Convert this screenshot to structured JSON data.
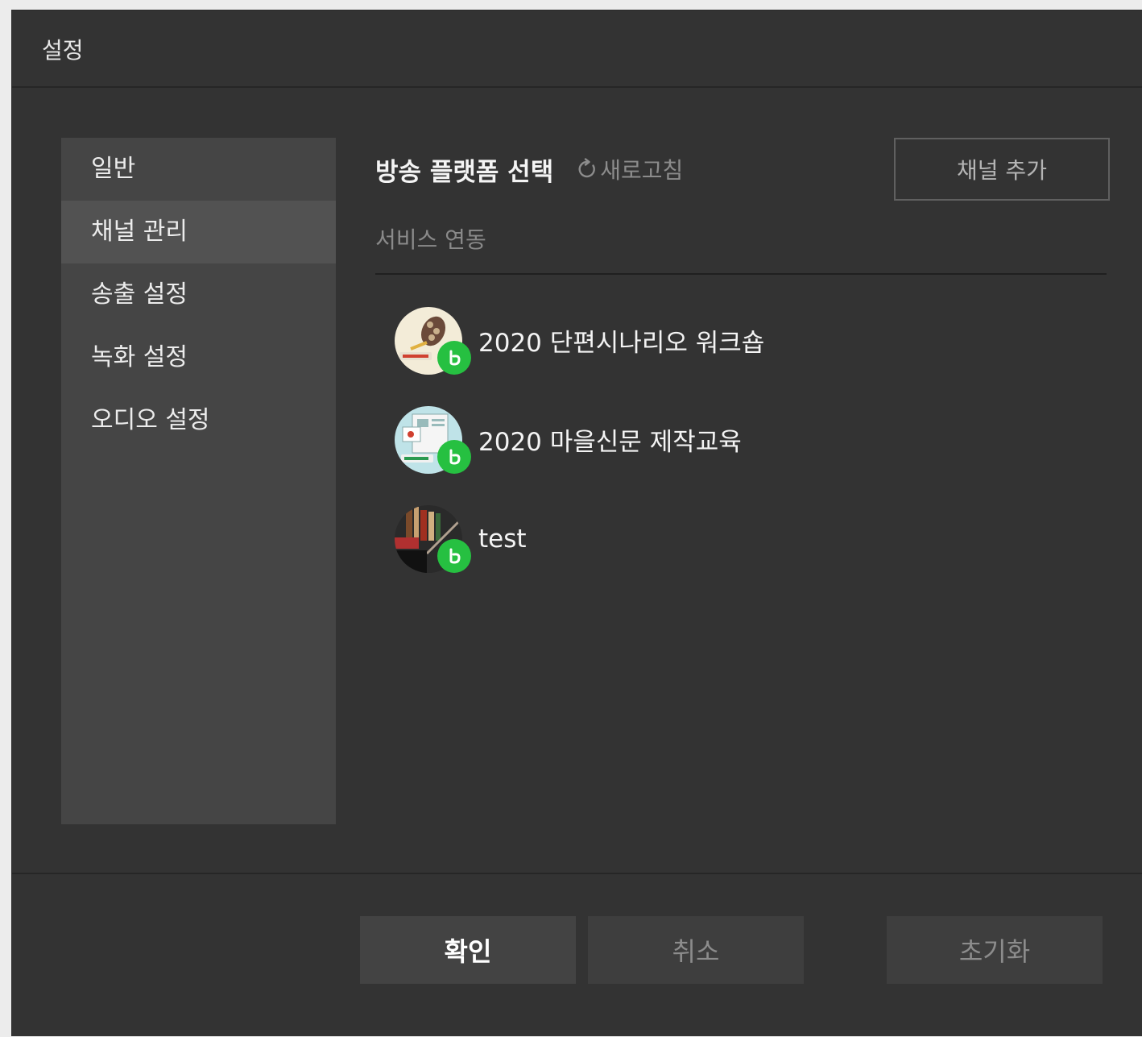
{
  "window": {
    "title": "설정"
  },
  "sidebar": {
    "items": [
      {
        "label": "일반",
        "active": false
      },
      {
        "label": "채널 관리",
        "active": true
      },
      {
        "label": "송출 설정",
        "active": false
      },
      {
        "label": "녹화 설정",
        "active": false
      },
      {
        "label": "오디오 설정",
        "active": false
      }
    ]
  },
  "main": {
    "section_title": "방송 플랫폼 선택",
    "refresh_label": "새로고침",
    "add_channel_label": "채널 추가",
    "service_label": "서비스 연동",
    "channels": [
      {
        "name": "2020 단편시나리오 워크숍",
        "avatar_icon": "film-reel-avatar",
        "badge_icon": "band-logo-icon"
      },
      {
        "name": "2020 마을신문 제작교육",
        "avatar_icon": "newspaper-avatar",
        "badge_icon": "band-logo-icon"
      },
      {
        "name": "test",
        "avatar_icon": "books-avatar",
        "badge_icon": "band-logo-icon"
      }
    ]
  },
  "footer": {
    "ok_label": "확인",
    "cancel_label": "취소",
    "reset_label": "초기화"
  },
  "colors": {
    "background": "#333333",
    "sidebar": "#454545",
    "sidebar_active": "#525252",
    "badge": "#26c041"
  }
}
